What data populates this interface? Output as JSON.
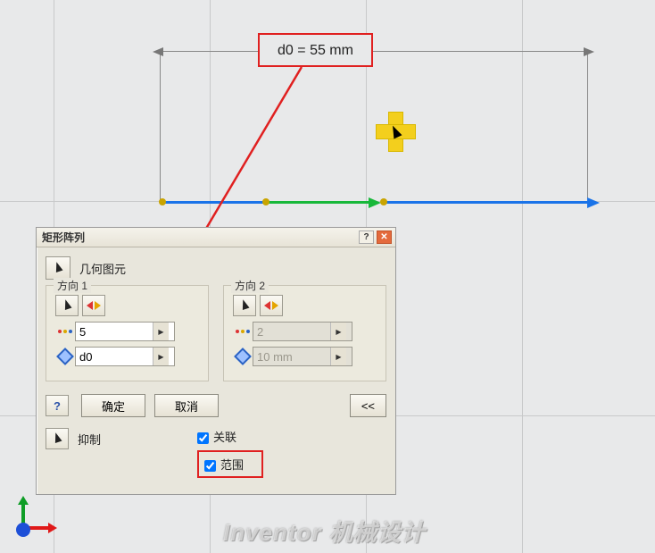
{
  "dimension": {
    "label": "d0 = 55 mm"
  },
  "dialog": {
    "title": "矩形阵列",
    "geometry_label": "几何图元",
    "dir1": {
      "title": "方向 1",
      "count": "5",
      "spacing": "d0"
    },
    "dir2": {
      "title": "方向 2",
      "count": "2",
      "spacing": "10 mm"
    },
    "buttons": {
      "ok": "确定",
      "cancel": "取消",
      "collapse": "<<"
    },
    "suppress_label": "抑制",
    "assoc_label": "关联",
    "range_label": "范围"
  },
  "watermark": "Inventor 机械设计"
}
